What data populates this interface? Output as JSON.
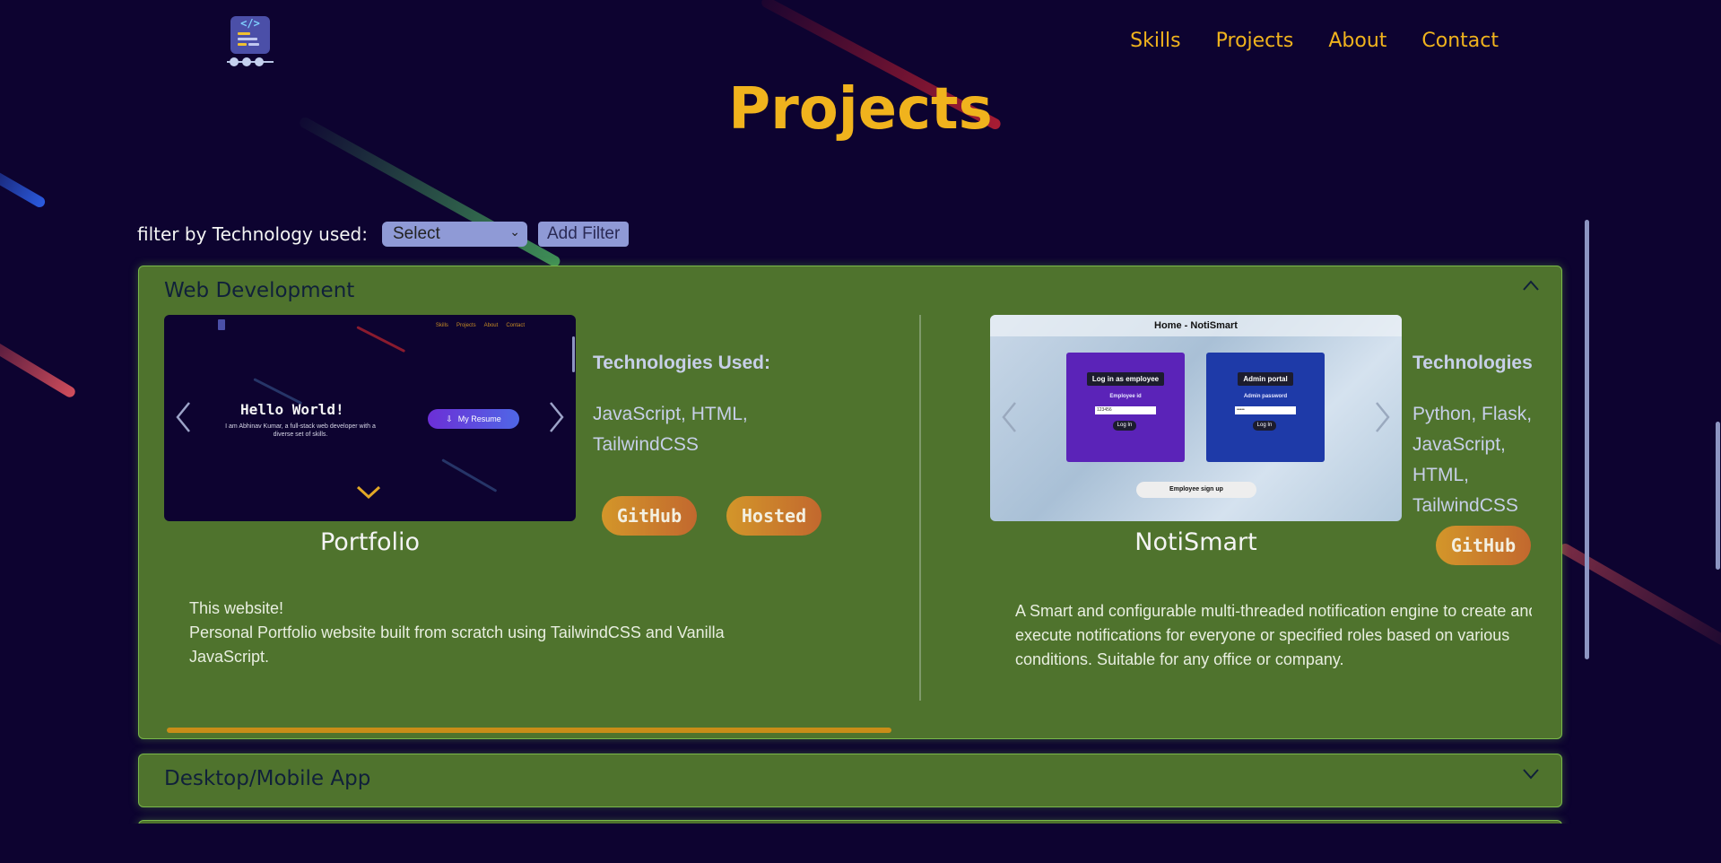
{
  "nav": {
    "items": [
      "Skills",
      "Projects",
      "About",
      "Contact"
    ]
  },
  "page": {
    "title": "Projects"
  },
  "filter": {
    "label": "filter by Technology used:",
    "selected": "Select",
    "add_button": "Add Filter"
  },
  "sections": {
    "web": {
      "title": "Web Development",
      "projects": [
        {
          "name": "Portfolio",
          "tech_heading": "Technologies Used:",
          "tech_list": "JavaScript, HTML, TailwindCSS",
          "buttons": [
            "GitHub",
            "Hosted"
          ],
          "description_line1": "This website!",
          "description_line2": "Personal Portfolio website built from scratch using TailwindCSS and Vanilla JavaScript.",
          "preview": {
            "nav": [
              "Skills",
              "Projects",
              "About",
              "Contact"
            ],
            "heading": "Hello World!",
            "subtitle": "I am Abhinav Kumar, a full-stack web developer with a diverse set of skills.",
            "resume_button": "My Resume"
          }
        },
        {
          "name": "NotiSmart",
          "tech_heading": "Technologies",
          "tech_list": "Python, Flask, JavaScript, HTML, TailwindCSS",
          "buttons": [
            "GitHub"
          ],
          "description": "A Smart and configurable multi-threaded notification engine to create and execute notifications for everyone or specified roles based on various conditions. Suitable for any office or company.",
          "preview": {
            "window_title": "Home - NotiSmart",
            "card1_title": "Log in as employee",
            "card1_label": "Employee id",
            "card1_value": "123456",
            "card2_title": "Admin portal",
            "card2_label": "Admin password",
            "card2_value": "•••••",
            "login_label": "Log In",
            "signup_label": "Employee sign up"
          }
        }
      ]
    },
    "desktop": {
      "title": "Desktop/Mobile App"
    }
  },
  "colors": {
    "background": "#0d0330",
    "accent": "#f0b31d",
    "card": "#4f732d",
    "card_border": "#79b84a"
  }
}
